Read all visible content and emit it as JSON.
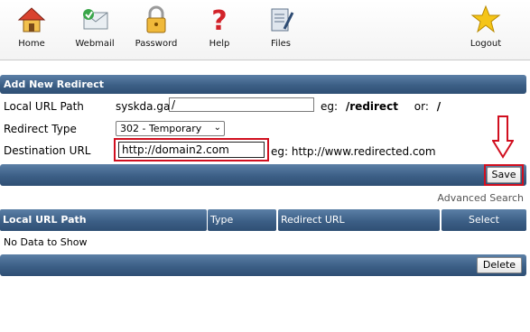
{
  "toolbar": {
    "items": [
      {
        "label": "Home",
        "icon": "house-icon"
      },
      {
        "label": "Webmail",
        "icon": "mail-icon"
      },
      {
        "label": "Password",
        "icon": "lock-icon"
      },
      {
        "label": "Help",
        "icon": "question-icon"
      },
      {
        "label": "Files",
        "icon": "files-icon"
      },
      {
        "label": "Logout",
        "icon": "star-icon"
      }
    ]
  },
  "form": {
    "title": "Add New Redirect",
    "local_url_label": "Local URL Path",
    "local_url_domain": "syskda.ga",
    "local_url_value": "/",
    "local_url_example_prefix": "eg:",
    "local_url_example_value": "/redirect",
    "local_url_example_or": "or:",
    "local_url_example_alt": "/",
    "redirect_type_label": "Redirect Type",
    "redirect_type_value": "302 - Temporary",
    "destination_label": "Destination URL",
    "destination_value": "http://domain2.com",
    "destination_example": "eg: http://www.redirected.com",
    "save_label": "Save"
  },
  "advanced_search_label": "Advanced Search",
  "table": {
    "columns": [
      "Local URL Path",
      "Type",
      "Redirect URL",
      "Select"
    ],
    "empty_text": "No Data to Show",
    "delete_label": "Delete"
  },
  "colors": {
    "bar_blue": "#3c5f86",
    "highlight_red": "#d10f1f"
  }
}
